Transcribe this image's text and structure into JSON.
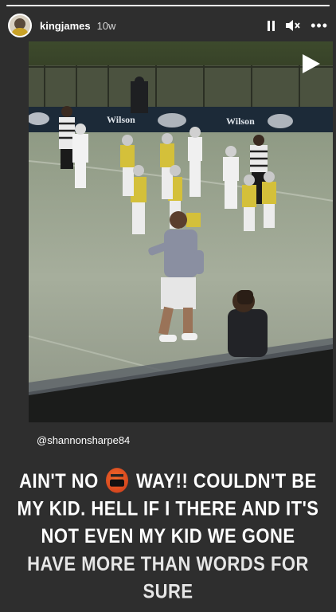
{
  "header": {
    "username": "kingjames",
    "time": "10w"
  },
  "video": {
    "sponsor_label": "Wilson"
  },
  "mention": "@shannonsharpe84",
  "caption": {
    "line1_a": "AIN'T NO",
    "line1_b": "WAY!! COULDN'T BE",
    "line2": "MY KID. HELL IF I THERE AND IT'S",
    "line3": "NOT EVEN MY KID WE GONE",
    "line4": "HAVE MORE THAN WORDS FOR",
    "line5": "SURE"
  },
  "icons": {
    "pause": "pause-icon",
    "mute": "speaker-mute-icon",
    "more": "more-options-icon",
    "play": "play-icon",
    "emoji": "cursing-face-emoji"
  }
}
